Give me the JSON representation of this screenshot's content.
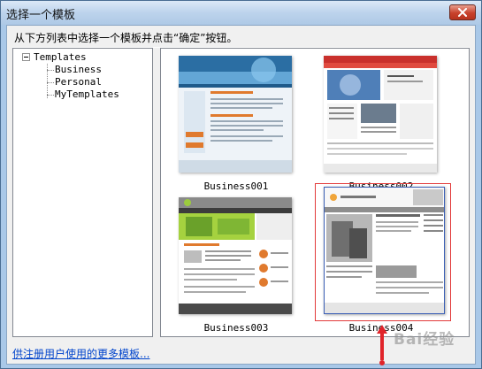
{
  "window": {
    "title": "选择一个模板",
    "instruction": "从下方列表中选择一个模板并点击“确定”按钮。",
    "link_text": "供注册用户使用的更多模板..."
  },
  "tree": {
    "root": "Templates",
    "children": [
      "Business",
      "Personal",
      "MyTemplates"
    ]
  },
  "templates": [
    {
      "name": "Business001",
      "selected": false,
      "icon": "template-thumbnail-blue"
    },
    {
      "name": "Business002",
      "selected": false,
      "icon": "template-thumbnail-red"
    },
    {
      "name": "Business003",
      "selected": false,
      "icon": "template-thumbnail-green"
    },
    {
      "name": "Business004",
      "selected": true,
      "icon": "template-thumbnail-gray"
    }
  ],
  "watermark": "Bai经验",
  "colors": {
    "selection": "#e23a3a",
    "link": "#0044cc",
    "title_bar": "#bcd3ec",
    "close_button": "#c8412b"
  }
}
